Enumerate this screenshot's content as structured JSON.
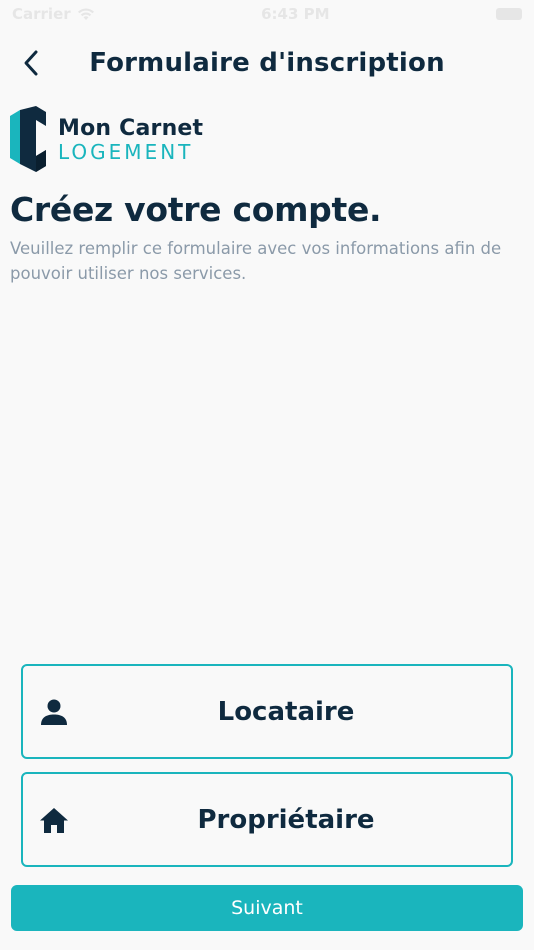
{
  "status_bar": {
    "carrier": "Carrier",
    "time": "6:43 PM"
  },
  "nav": {
    "title": "Formulaire d'inscription"
  },
  "logo": {
    "line1": "Mon Carnet",
    "line2": "LOGEMENT"
  },
  "intro": {
    "headline": "Créez votre compte.",
    "description": "Veuillez remplir ce formulaire avec vos informations afin de pouvoir utiliser nos services."
  },
  "roles": [
    {
      "label": "Locataire",
      "icon": "person-icon"
    },
    {
      "label": "Propriétaire",
      "icon": "home-icon"
    }
  ],
  "next_button": {
    "label": "Suivant"
  },
  "colors": {
    "accent": "#1ab5bd",
    "navy": "#0f2a3f",
    "muted": "#8b9aa9",
    "background": "#f9f9f9"
  }
}
